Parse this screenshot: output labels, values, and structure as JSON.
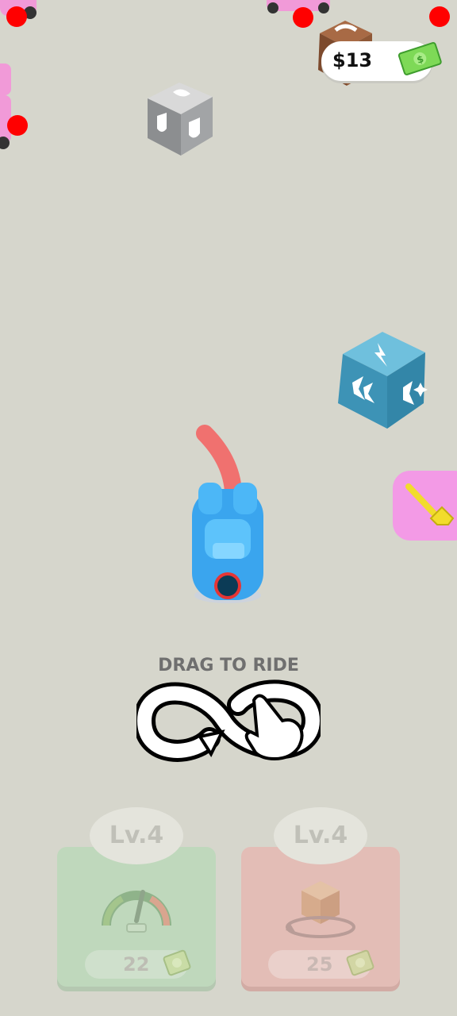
{
  "hud": {
    "money": "$13"
  },
  "tutorial": {
    "text": "DRAG TO RIDE"
  },
  "upgrades": [
    {
      "name": "speed",
      "level": "Lv.4",
      "price": "22",
      "color": "#bfd8bc"
    },
    {
      "name": "crate",
      "level": "Lv.4",
      "price": "25",
      "color": "#e3bdb6"
    }
  ],
  "icons": {
    "money": "cash-icon",
    "side_button": "plunger-icon",
    "speed": "speedometer-icon",
    "crate": "crate-rotate-icon"
  },
  "colors": {
    "background": "#d6d6cc",
    "player_car": "#3aa5ee",
    "trail": "#f0716f",
    "enemy_marker": "#ff0000"
  }
}
